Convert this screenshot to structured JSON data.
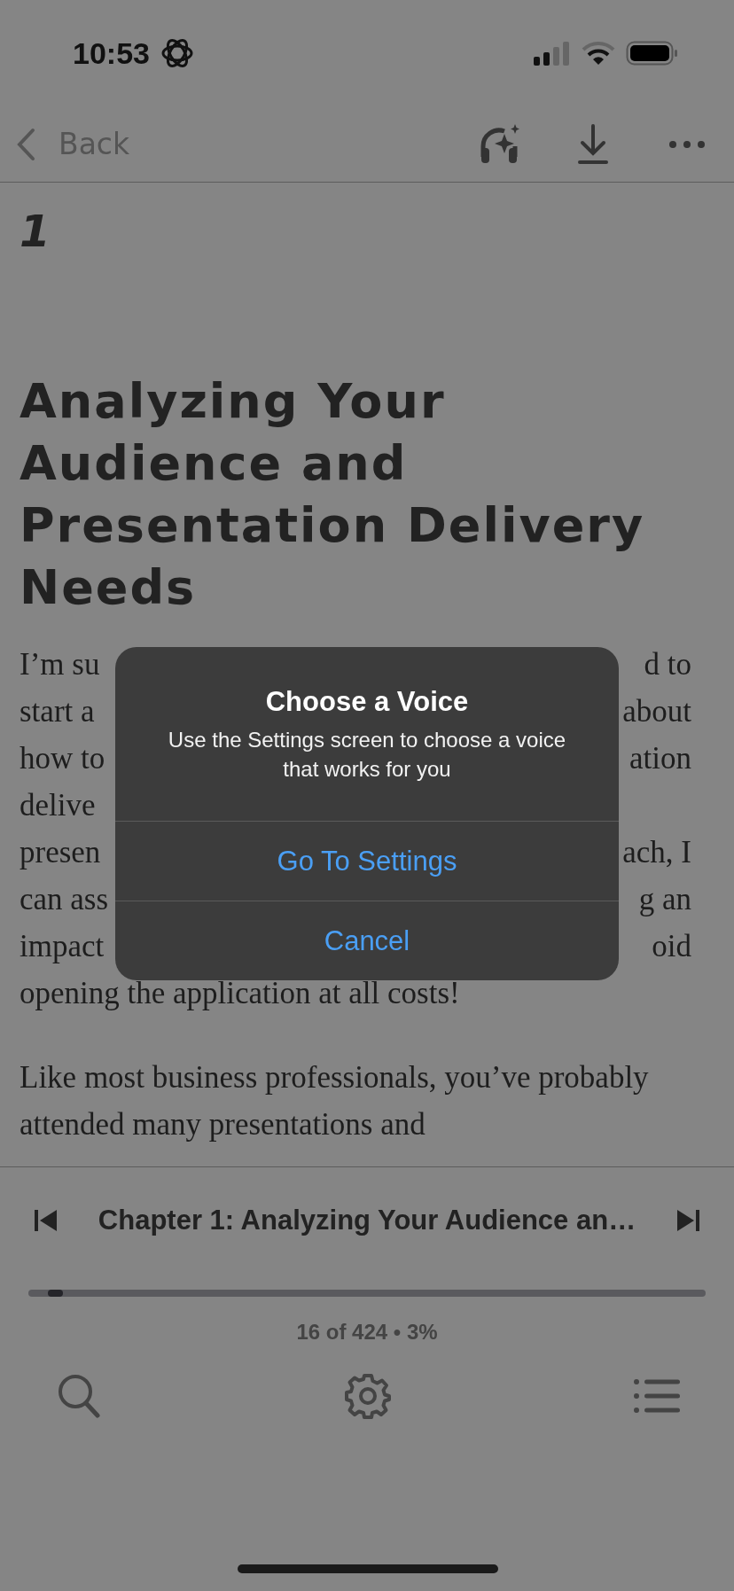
{
  "status_bar": {
    "time": "10:53"
  },
  "nav": {
    "back": "Back"
  },
  "chapter_number": "1",
  "heading": "Analyzing Your Audience and Presentation Delivery Needs",
  "paragraph_fragments": [
    {
      "left": "I’m su",
      "right": "d to"
    },
    {
      "left": "start a",
      "right": "about"
    },
    {
      "left": "how to",
      "right": "ation"
    },
    {
      "left": "delive"
    },
    {
      "left": "presen",
      "right": "ach, I"
    },
    {
      "left": "can ass",
      "right": "g an"
    },
    {
      "left": "impact",
      "right": "oid"
    }
  ],
  "paragraph_end": "opening the application at all costs!",
  "paragraph_2": "Like most business professionals, you’ve probably attended many presentations and",
  "player": {
    "chapter_title": "Chapter 1: Analyzing Your Audience an…",
    "level": 0.03,
    "position": "16 of 424 • 3%"
  },
  "dialog": {
    "title": "Choose a Voice",
    "message": "Use the Settings screen to choose a voice that works for you",
    "buttons": [
      "Go To Settings",
      "Cancel"
    ]
  }
}
